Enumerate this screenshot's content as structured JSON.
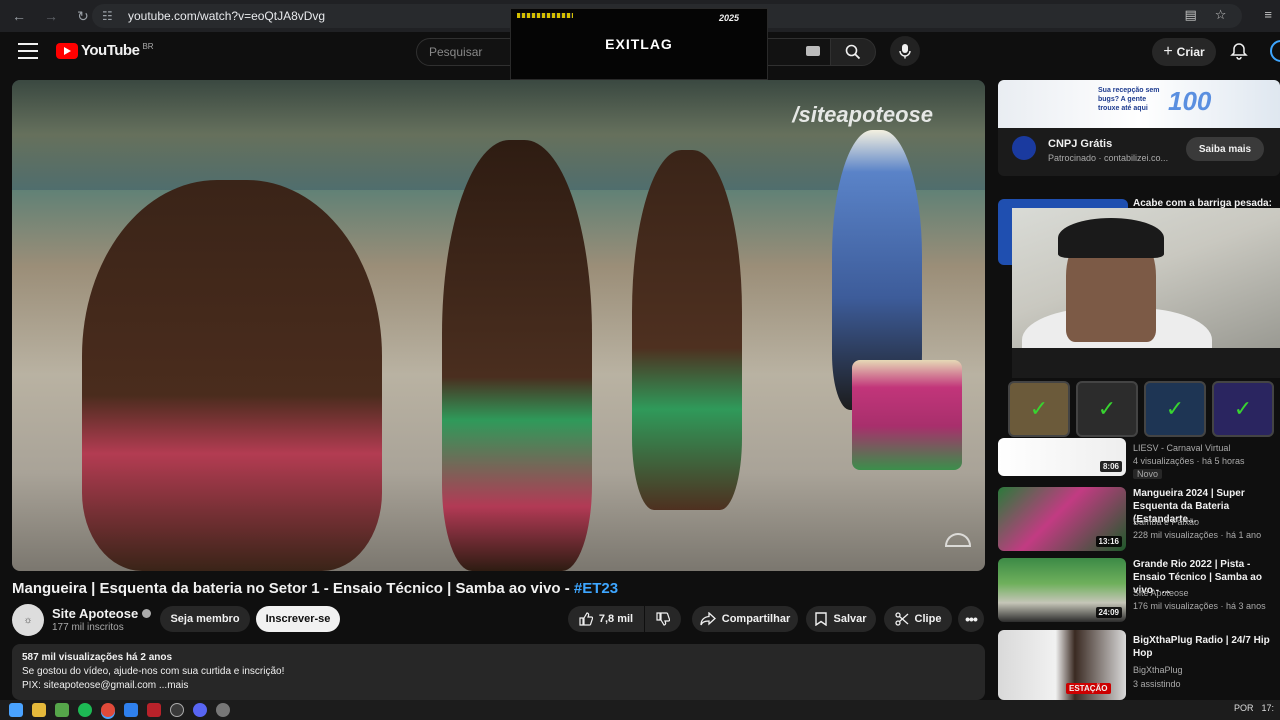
{
  "browser": {
    "url": "youtube.com/watch?v=eoQtJA8vDvg"
  },
  "youtube": {
    "logo_text": "YouTube",
    "region": "BR",
    "search_placeholder": "Pesquisar",
    "create_label": "Criar"
  },
  "overlay": {
    "brand": "EXITLAG",
    "year": "2025"
  },
  "video": {
    "watermark": "/siteapoteose",
    "title": "Mangueira | Esquenta da bateria no Setor 1 - Ensaio Técnico | Samba ao vivo - ",
    "hashtag": "#ET23"
  },
  "channel": {
    "name": "Site Apoteose",
    "subscribers": "177 mil inscritos",
    "join_label": "Seja membro",
    "subscribe_label": "Inscrever-se"
  },
  "actions": {
    "likes": "7,8 mil",
    "share": "Compartilhar",
    "save": "Salvar",
    "clip": "Clipe"
  },
  "description": {
    "meta": "587 mil visualizações  há 2 anos",
    "line1": "Se gostou do vídeo, ajude-nos com sua curtida e inscrição!",
    "line2": "PIX: siteapoteose@gmail.com  ...mais"
  },
  "ad": {
    "banner_text": "Sua recepção sem bugs? A gente trouxe até aqui",
    "banner_number": "100",
    "name": "CNPJ Grátis",
    "sponsored": "Patrocinado · contabilizei.co...",
    "cta": "Saiba mais"
  },
  "webcam_heading": "Acabe com a barriga pesada:",
  "recommendations": [
    {
      "title": "LIESV - Carnaval Virtual",
      "channel": "4 visualizações · há 5 horas",
      "views": "Novo",
      "duration": "8:06"
    },
    {
      "title": "Mangueira 2024 | Super Esquenta da Bateria (Estandarte...",
      "channel": "Samba é Paixão",
      "views": "228 mil visualizações · há 1 ano",
      "duration": "13:16"
    },
    {
      "title": "Grande Rio 2022 | Pista - Ensaio Técnico | Samba ao vivo - ...",
      "channel": "Site Apoteose",
      "views": "176 mil visualizações · há 3 anos",
      "duration": "24:09"
    },
    {
      "title": "BigXthaPlug Radio | 24/7 Hip Hop",
      "channel": "BigXthaPlug",
      "views": "3 assistindo",
      "duration": "ESTAÇÃO"
    }
  ],
  "taskbar": {
    "lang": "POR",
    "time": "17:"
  },
  "colors": {
    "accent": "#3ea6ff",
    "brand_red": "#ff0000",
    "background": "#0f0f0f"
  }
}
